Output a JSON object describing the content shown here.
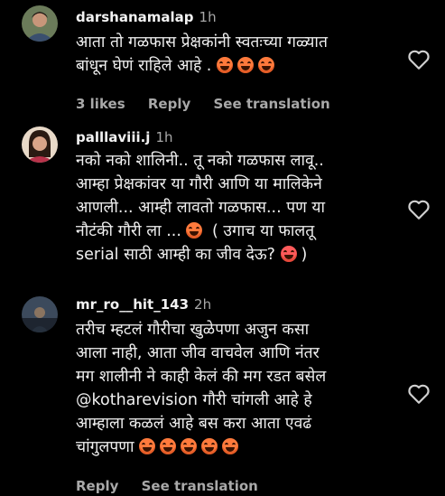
{
  "comments": [
    {
      "username": "darshanamalap",
      "time": "1h",
      "lines": [
        "आता तो गळफास प्रेक्षकांनी स्वतःच्या गळ्यात",
        "बांधून घेणं राहिले आहे ."
      ],
      "emoji_line2_count": 3,
      "likes": "3 likes",
      "reply": "Reply",
      "translation": "See translation"
    },
    {
      "username": "palllaviii.j",
      "time": "1h",
      "lines": [
        "नको नको शालिनी.. तू नको गळफास लावू..",
        "आम्हा प्रेक्षकांवर या गौरी आणि या मालिकेने",
        "आणली... आम्ही लावतो गळफास... पण या",
        "नौटंकी गौरी ला ...",
        "( उगाच या फालतू",
        "serial साठी आम्ही का जीव देऊ?",
        ")"
      ]
    },
    {
      "username": "mr_ro__hit_143",
      "time": "2h",
      "lines": [
        "तरीच म्हटलं गौरीचा खुळेपणा अजुन कसा",
        "आला नाही, आता जीव वाचवेल आणि नंतर",
        "मग शालीनी ने काही केलं की मग रडत बसेल",
        "@kotharevision गौरी चांगली आहे हे",
        "आम्हाला कळलं आहे बस करा आता एवढं",
        "चांगुलपणा"
      ],
      "reply": "Reply",
      "translation": "See translation"
    }
  ],
  "colors": {
    "background": "#000000",
    "muted": "#a8a8a8",
    "emoji": "#ff7a3c"
  },
  "icons": [
    "heart-outline-icon"
  ]
}
